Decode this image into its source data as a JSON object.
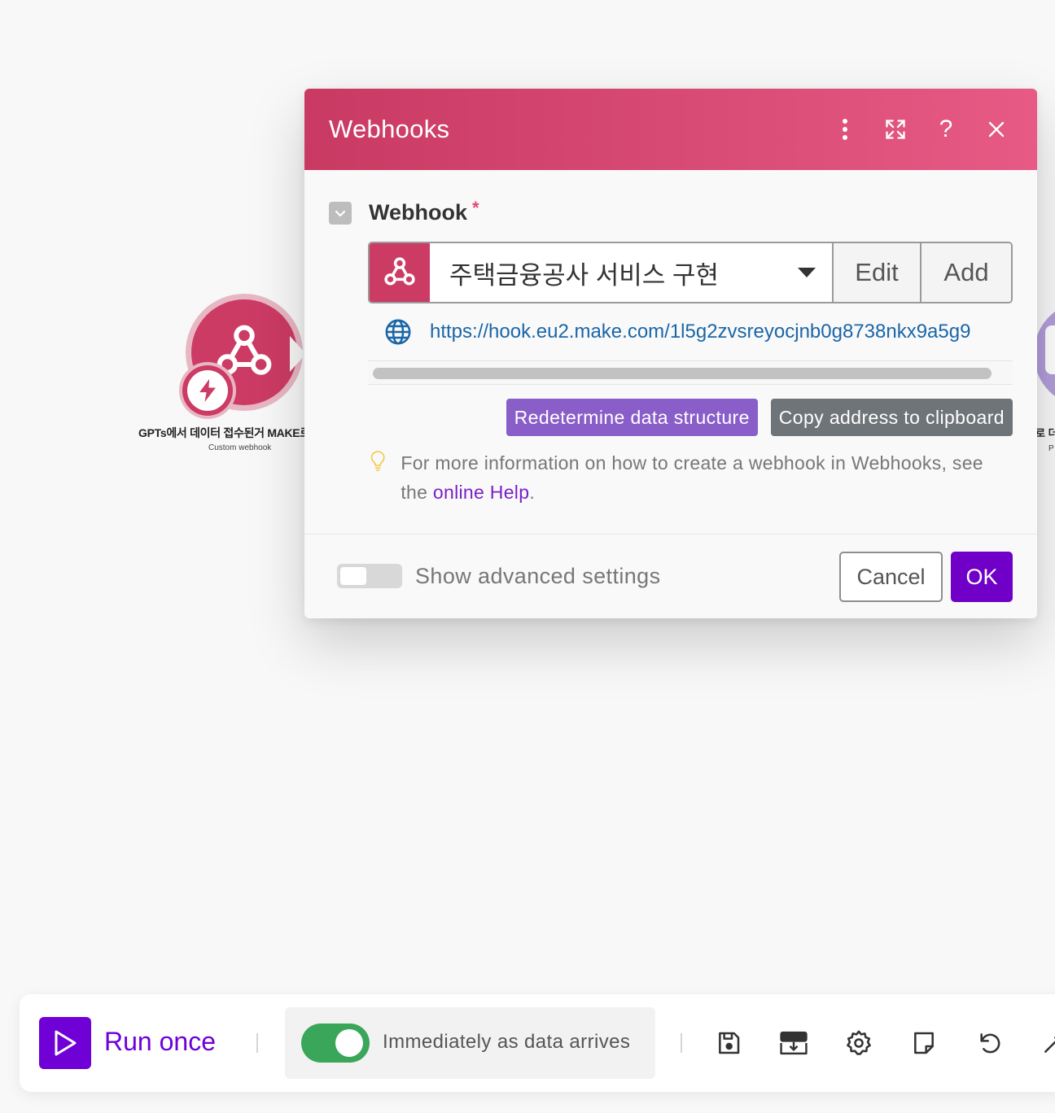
{
  "canvas": {
    "left_module": {
      "title": "GPTs에서 데이터 접수된거 MAKE로",
      "subtitle": "Custom webhook",
      "icon": "webhook-icon",
      "badge_icon": "lightning-icon",
      "color": "#cc3b64"
    },
    "right_module": {
      "title": "로 더",
      "subtitle": "P",
      "color": "#b39ddb"
    }
  },
  "dialog": {
    "title": "Webhooks",
    "header_icons": [
      "more-vertical-icon",
      "expand-icon",
      "help-icon",
      "close-icon"
    ],
    "help_label": "?",
    "field_label": "Webhook",
    "required_mark": "*",
    "selected_webhook": "주택금융공사 서비스 구현",
    "edit_label": "Edit",
    "add_label": "Add",
    "url": "https://hook.eu2.make.com/1l5g2zvsreyocjnb0g8738nkx9a5g9",
    "redetermine_label": "Redetermine data structure",
    "copy_label": "Copy address to clipboard",
    "info_text": "For more information on how to create a webhook in Webhooks, see the ",
    "info_link": "online Help",
    "info_end": ".",
    "advanced_label": "Show advanced settings",
    "advanced_enabled": false,
    "cancel_label": "Cancel",
    "ok_label": "OK",
    "accent_color": "#cc3b64",
    "ok_color": "#7000c8"
  },
  "toolbar": {
    "run_label": "Run once",
    "schedule_label": "Immediately as data arrives",
    "schedule_enabled": true,
    "icons": [
      "save-icon",
      "import-export-icon",
      "settings-icon",
      "notes-icon",
      "undo-icon",
      "magic-wand-icon"
    ],
    "run_color": "#6f00d6",
    "toggle_color": "#3aa65a"
  }
}
